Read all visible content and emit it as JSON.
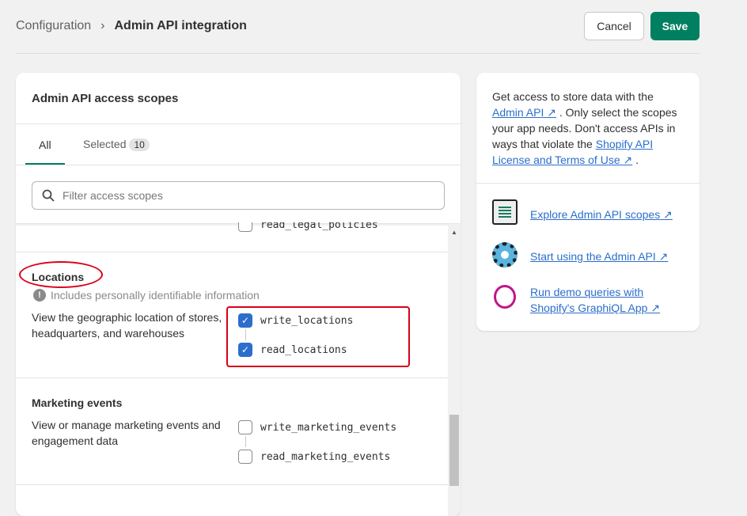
{
  "breadcrumb": {
    "parent": "Configuration",
    "current": "Admin API integration"
  },
  "actions": {
    "cancel": "Cancel",
    "save": "Save"
  },
  "scopes_card": {
    "title": "Admin API access scopes",
    "tabs": [
      {
        "label": "All",
        "active": true
      },
      {
        "label": "Selected",
        "count": "10"
      }
    ],
    "search_placeholder": "Filter access scopes",
    "partial_item": "read_legal_policies",
    "sections": [
      {
        "title": "Locations",
        "warning": "Includes personally identifiable information",
        "description": "View the geographic location of stores, headquarters, and warehouses",
        "scopes": [
          {
            "name": "write_locations",
            "checked": true
          },
          {
            "name": "read_locations",
            "checked": true
          }
        ]
      },
      {
        "title": "Marketing events",
        "description": "View or manage marketing events and engagement data",
        "scopes": [
          {
            "name": "write_marketing_events",
            "checked": false
          },
          {
            "name": "read_marketing_events",
            "checked": false
          }
        ]
      }
    ]
  },
  "info_card": {
    "t1": "Get access to store data with the ",
    "l1": "Admin API",
    "t2": " . Only select the scopes your app needs. Don't access APIs in ways that violate the ",
    "l2": "Shopify API License and Terms of Use",
    "t3": " .",
    "links": [
      {
        "label": "Explore Admin API scopes",
        "icon": "scroll-document-icon"
      },
      {
        "label": "Start using the Admin API",
        "icon": "gear-icon"
      },
      {
        "label": "Run demo queries with Shopify's GraphiQL App",
        "icon": "graphql-icon"
      }
    ]
  },
  "colors": {
    "accent": "#008060",
    "link": "#2c6ecb",
    "annotation": "#d9001b"
  }
}
